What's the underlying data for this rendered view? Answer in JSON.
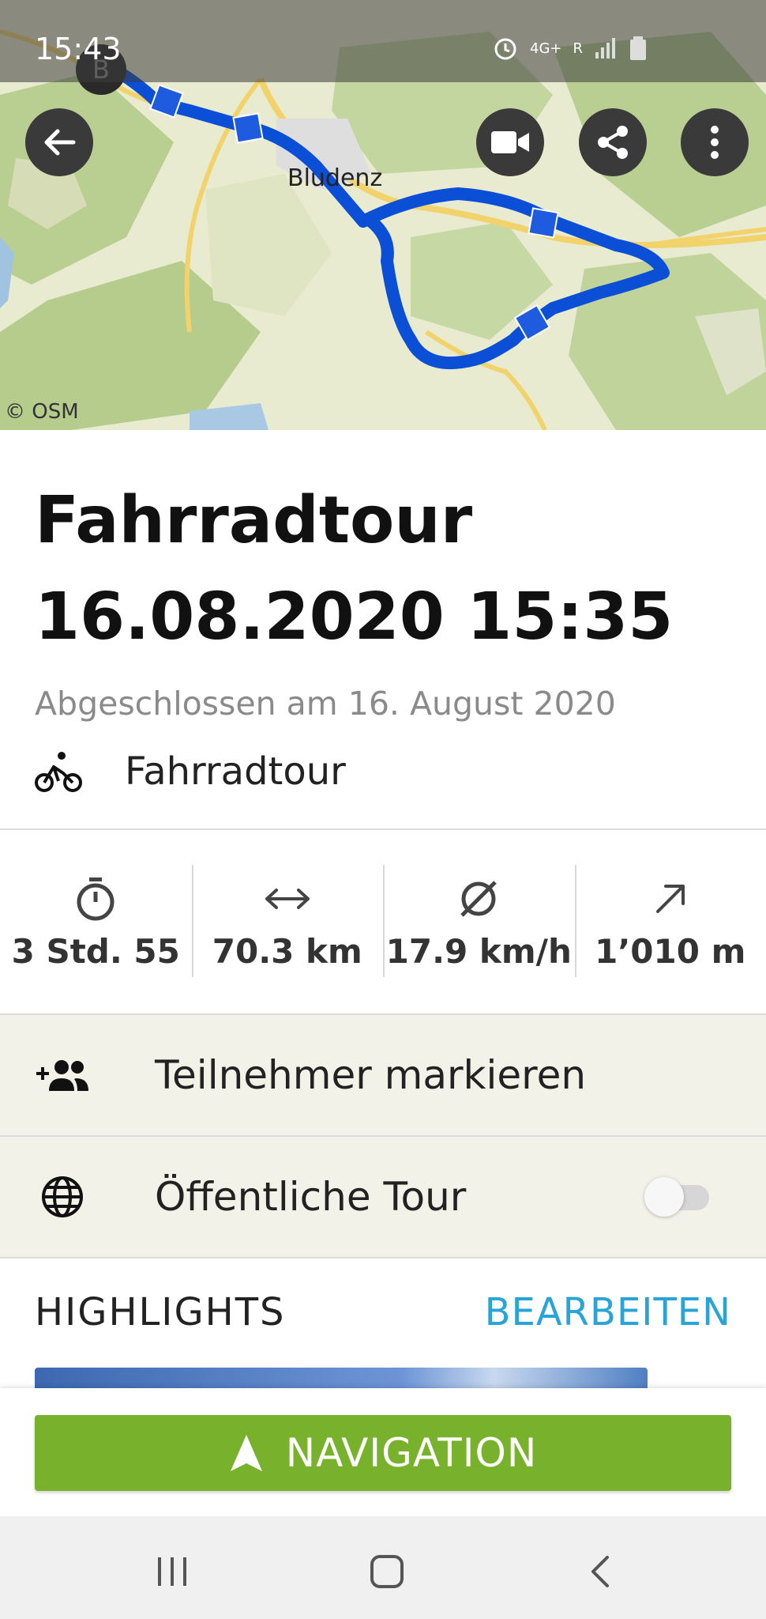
{
  "status_bar": {
    "time": "15:43",
    "network": "4G+",
    "roaming": "R"
  },
  "map": {
    "attribution": "© OSM",
    "town_label": "Bludenz",
    "start_marker": "B",
    "buttons": {
      "back_icon": "arrow-left-icon",
      "video_icon": "video-camera-icon",
      "share_icon": "share-icon",
      "more_icon": "more-vert-icon"
    }
  },
  "tour": {
    "title": "Fahrradtour 16.08.2020 15:35",
    "completed": "Abgeschlossen am 16. August 2020",
    "type_label": "Fahrradtour",
    "type_icon": "bicycle-icon"
  },
  "stats": [
    {
      "icon": "stopwatch-icon",
      "value": "3 Std. 55"
    },
    {
      "icon": "horizontal-arrows-icon",
      "value": "70.3 km"
    },
    {
      "icon": "diameter-icon",
      "value": "17.9 km/h"
    },
    {
      "icon": "arrow-up-right-icon",
      "value": "1’010 m"
    }
  ],
  "rows": {
    "participants": {
      "label": "Teilnehmer markieren",
      "icon": "add-people-icon"
    },
    "public_tour": {
      "label": "Öffentliche Tour",
      "icon": "globe-icon",
      "toggle_on": false
    }
  },
  "highlights": {
    "title": "HIGHLIGHTS",
    "edit_label": "BEARBEITEN"
  },
  "navigation": {
    "label": "NAVIGATION"
  },
  "colors": {
    "accent_green": "#78b22d",
    "link_blue": "#2aa3d6",
    "route_blue": "#0b4fd6"
  }
}
